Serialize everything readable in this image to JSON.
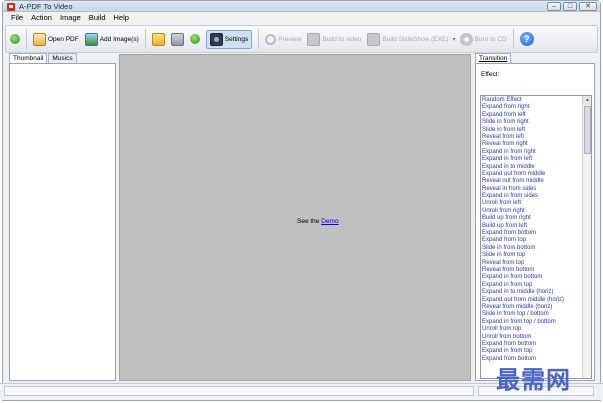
{
  "window": {
    "title": "A-PDF To Video"
  },
  "menu": [
    "File",
    "Action",
    "Image",
    "Build",
    "Help"
  ],
  "toolbar": {
    "open_pdf": "Open PDF",
    "add_images": "Add Image(s)",
    "settings": "Settings",
    "preview": "Preview",
    "build_video": "Build to video",
    "build_slideshow": "Build SlideShow (EXE)",
    "burn_cd": "Burn to CD",
    "help": "?"
  },
  "left_tabs": [
    "Thumbnail",
    "Musics"
  ],
  "preview": {
    "text": "See the",
    "link": "Demo"
  },
  "right_tabs": [
    "Transition"
  ],
  "transition": {
    "effect_label": "Effect:",
    "effects": [
      "Random Effect",
      "Expand from right",
      "Expand from left",
      "Slide in from right",
      "Slide in from left",
      "Reveal from left",
      "Reveal from right",
      "Expand in from right",
      "Expand in from left",
      "Expand in to middle",
      "Expand out from middle",
      "Reveal out from middle",
      "Reveal in from sides",
      "Expand in from sides",
      "Unroll from left",
      "Unroll from right",
      "Build up from right",
      "Build up from left",
      "Expand from bottom",
      "Expand from top",
      "Slide in from bottom",
      "Slide in from top",
      "Reveal from top",
      "Reveal from bottom",
      "Expand in from bottom",
      "Expand in from top",
      "Expand in to middle (horiz)",
      "Expand out from middle (horiz)",
      "Reveal from middle (horiz)",
      "Slide in from top / bottom",
      "Expand in from top / bottom",
      "Unroll from top",
      "Unroll from bottom",
      "Expand from bottom",
      "Expand in from top",
      "Expand from bottom"
    ]
  },
  "watermark": "最需网"
}
